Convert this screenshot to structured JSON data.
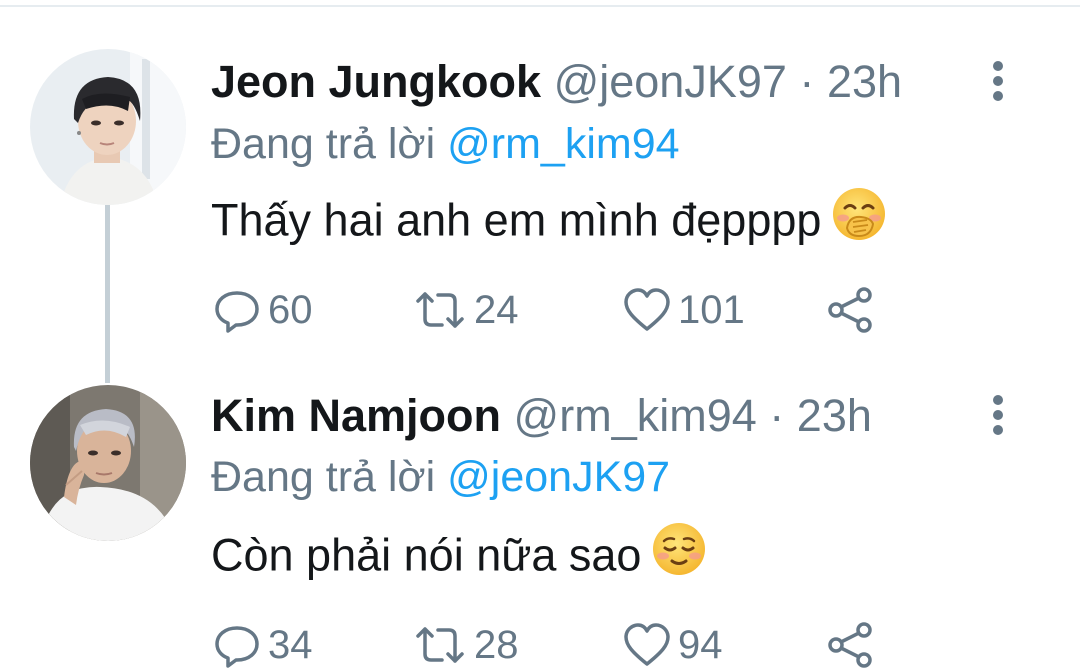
{
  "tweets": [
    {
      "name": "Jeon Jungkook",
      "handle": "@jeonJK97",
      "time": "23h",
      "reply_label": "Đang trả lời",
      "reply_to": "@rm_kim94",
      "text": "Thấy hai anh em mình đẹpppp",
      "emoji": "hand-over-mouth-emoji",
      "replies": "60",
      "retweets": "24",
      "likes": "101"
    },
    {
      "name": "Kim Namjoon",
      "handle": "@rm_kim94",
      "time": "23h",
      "reply_label": "Đang trả lời",
      "reply_to": "@jeonJK97",
      "text": "Còn phải nói nữa sao",
      "emoji": "relieved-face-emoji",
      "replies": "34",
      "retweets": "28",
      "likes": "94"
    }
  ],
  "separator": "·",
  "colors": {
    "link": "#1da1f2",
    "secondary_text": "#657786",
    "thread_line": "#c4cfd6"
  },
  "icons": [
    "reply-icon",
    "retweet-icon",
    "like-icon",
    "share-icon",
    "more-options-icon"
  ]
}
